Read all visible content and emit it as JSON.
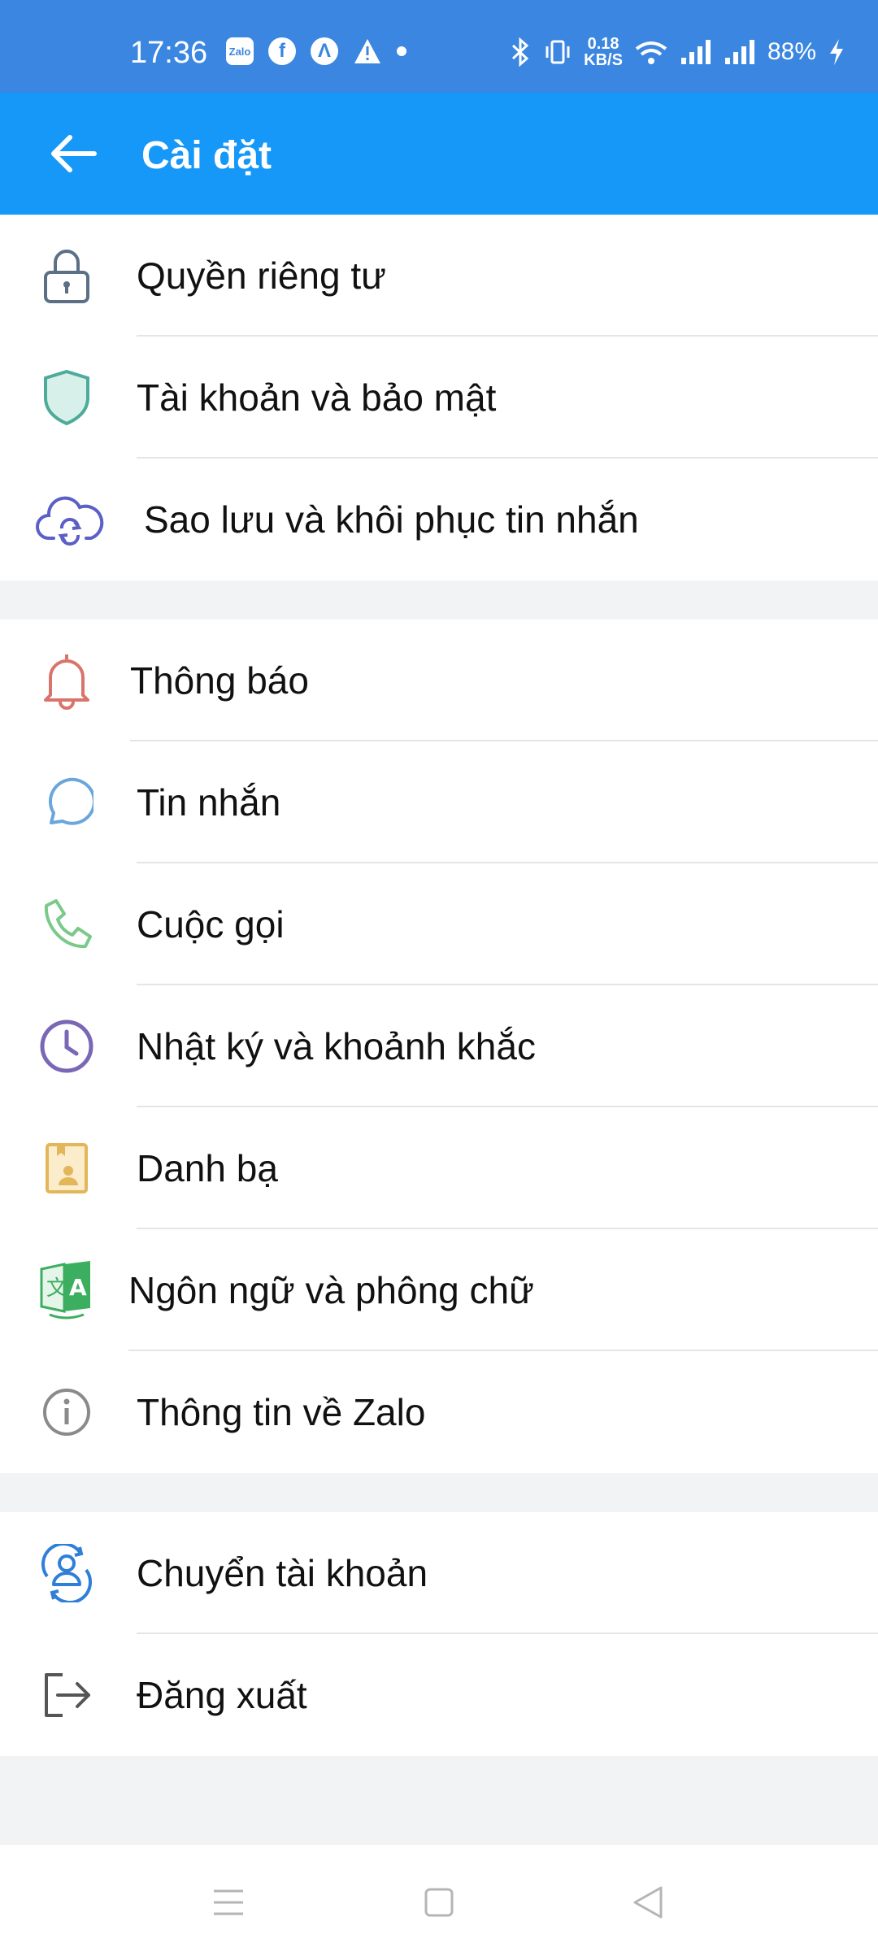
{
  "status_bar": {
    "time": "17:36",
    "notification_icons": [
      "zalo-icon",
      "facebook-icon",
      "app-a-icon",
      "warning-icon",
      "dot-icon"
    ],
    "zalo_badge": "Zalo",
    "net_speed_value": "0.18",
    "net_speed_unit": "KB/S",
    "battery": "88%"
  },
  "header": {
    "title": "Cài đặt",
    "background": "#1598f7"
  },
  "groups": [
    {
      "items": [
        {
          "label": "Quyền riêng tư",
          "icon": "lock-icon",
          "color": "#5b7087"
        },
        {
          "label": "Tài khoản và bảo mật",
          "icon": "shield-icon",
          "color": "#4dab9a"
        },
        {
          "label": "Sao lưu và khôi phục tin nhắn",
          "icon": "cloud-sync-icon",
          "color": "#5b5fc7"
        }
      ]
    },
    {
      "items": [
        {
          "label": "Thông báo",
          "icon": "bell-icon",
          "color": "#d9746c"
        },
        {
          "label": "Tin nhắn",
          "icon": "chat-bubble-icon",
          "color": "#6aa6dc"
        },
        {
          "label": "Cuộc gọi",
          "icon": "phone-icon",
          "color": "#7ac98a"
        },
        {
          "label": "Nhật ký và khoảnh khắc",
          "icon": "clock-icon",
          "color": "#7a67b5"
        },
        {
          "label": "Danh bạ",
          "icon": "contacts-icon",
          "color": "#e3b65a"
        },
        {
          "label": "Ngôn ngữ và phông chữ",
          "icon": "language-icon",
          "color": "#3cae5f"
        },
        {
          "label": "Thông tin về Zalo",
          "icon": "info-icon",
          "color": "#8a8a8a"
        }
      ]
    },
    {
      "items": [
        {
          "label": "Chuyển tài khoản",
          "icon": "switch-account-icon",
          "color": "#2f7fd8"
        },
        {
          "label": "Đăng xuất",
          "icon": "logout-icon",
          "color": "#555555"
        }
      ]
    }
  ],
  "nav_bar": {
    "buttons": [
      "menu-icon",
      "home-icon",
      "back-triangle-icon"
    ]
  }
}
